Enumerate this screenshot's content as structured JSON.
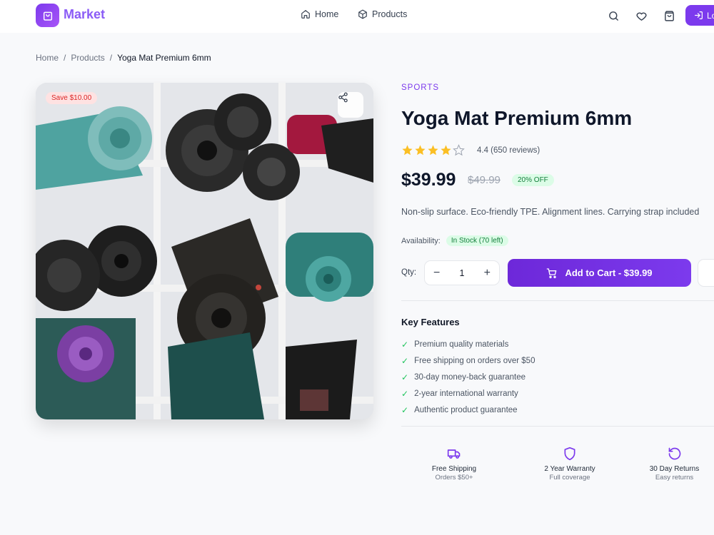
{
  "header": {
    "brand": "Market",
    "nav": [
      {
        "label": "Home",
        "icon": "home-icon"
      },
      {
        "label": "Products",
        "icon": "box-icon"
      }
    ],
    "login_label": "Lo"
  },
  "breadcrumb": [
    "Home",
    "Products",
    "Yoga Mat Premium 6mm"
  ],
  "product": {
    "save_badge": "Save $10.00",
    "category": "SPORTS",
    "title": "Yoga Mat Premium 6mm",
    "rating_value": 4.4,
    "rating_text": "4.4 (650 reviews)",
    "price": "$39.99",
    "old_price": "$49.99",
    "discount": "20% OFF",
    "description": "Non-slip surface. Eco-friendly TPE. Alignment lines. Carrying strap included",
    "availability_label": "Availability:",
    "stock": "In Stock (70 left)",
    "qty_label": "Qty:",
    "qty": "1",
    "cart_label": "Add to Cart - $39.99"
  },
  "features": {
    "title": "Key Features",
    "items": [
      "Premium quality materials",
      "Free shipping on orders over $50",
      "30-day money-back guarantee",
      "2-year international warranty",
      "Authentic product guarantee"
    ]
  },
  "trust": [
    {
      "title": "Free Shipping",
      "sub": "Orders $50+",
      "icon": "truck-icon"
    },
    {
      "title": "2 Year Warranty",
      "sub": "Full coverage",
      "icon": "shield-icon"
    },
    {
      "title": "30 Day Returns",
      "sub": "Easy returns",
      "icon": "return-icon"
    }
  ],
  "colors": {
    "accent": "#7c3aed",
    "star": "#fbbf24",
    "success": "#15803d",
    "danger": "#dc2626"
  }
}
